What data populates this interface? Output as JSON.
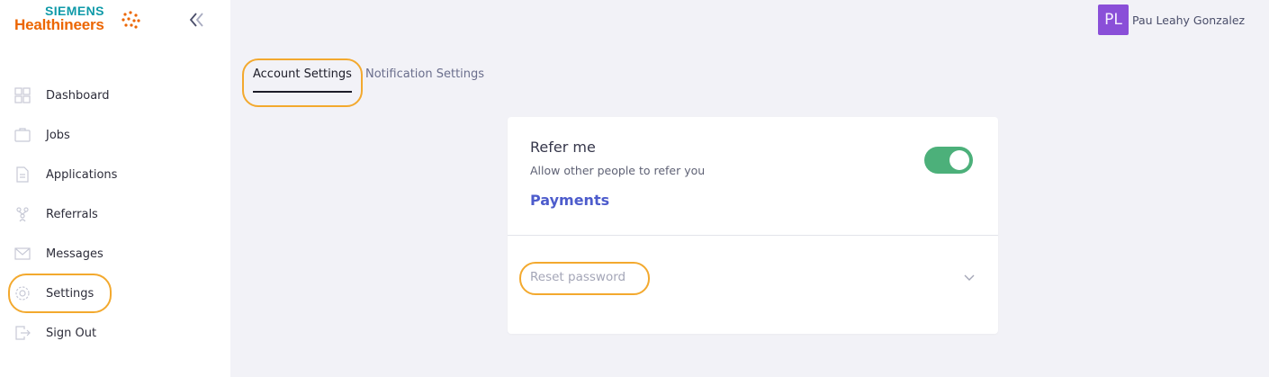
{
  "brand": {
    "line1": "SIEMENS",
    "line2": "Healthineers"
  },
  "sidebar": {
    "items": [
      {
        "label": "Dashboard",
        "icon": "dashboard-icon"
      },
      {
        "label": "Jobs",
        "icon": "briefcase-icon"
      },
      {
        "label": "Applications",
        "icon": "document-icon"
      },
      {
        "label": "Referrals",
        "icon": "referrals-icon"
      },
      {
        "label": "Messages",
        "icon": "envelope-icon"
      },
      {
        "label": "Settings",
        "icon": "gear-icon",
        "highlighted": true
      },
      {
        "label": "Sign Out",
        "icon": "sign-out-icon"
      }
    ]
  },
  "header": {
    "avatar_initials": "PL",
    "user_name": "Pau Leahy Gonzalez"
  },
  "tabs": [
    {
      "label": "Account Settings",
      "active": true
    },
    {
      "label": "Notification Settings",
      "active": false
    }
  ],
  "account": {
    "refer_title": "Refer me",
    "refer_subtitle": "Allow other people to refer you",
    "refer_enabled": true,
    "payments_label": "Payments",
    "reset_password_label": "Reset password"
  },
  "colors": {
    "accent_teal": "#0f9aa8",
    "brand_orange": "#ec6602",
    "toggle_on": "#4cb07a",
    "link_blue": "#4d5ccc",
    "avatar_purple": "#8a4fd8",
    "highlight": "#f3a92e"
  }
}
